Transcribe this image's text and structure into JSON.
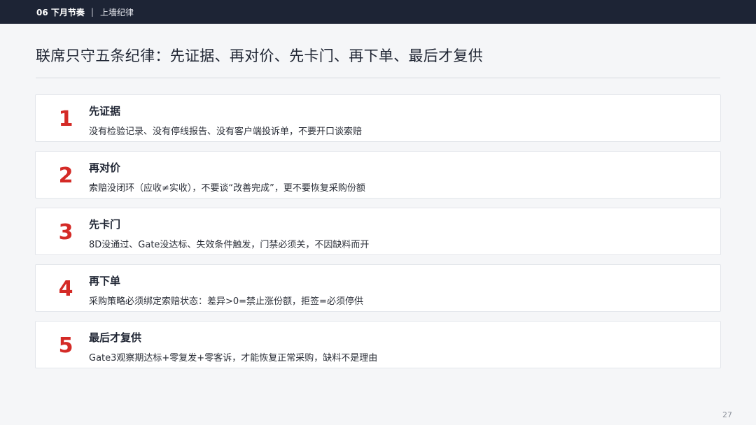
{
  "header": {
    "section_label": "06 下月节奏",
    "separator": "|",
    "subtitle": "上墙纪律"
  },
  "title": "联席只守五条纪律：先证据、再对价、先卡门、再下单、最后才复供",
  "rules": [
    {
      "number": "1",
      "heading": "先证据",
      "description": "没有检验记录、没有停线报告、没有客户端投诉单，不要开口谈索赔"
    },
    {
      "number": "2",
      "heading": "再对价",
      "description": "索赔没闭环（应收≠实收），不要谈“改善完成”，更不要恢复采购份额"
    },
    {
      "number": "3",
      "heading": "先卡门",
      "description": "8D没通过、Gate没达标、失效条件触发，门禁必须关，不因缺料而开"
    },
    {
      "number": "4",
      "heading": "再下单",
      "description": "采购策略必须绑定索赔状态：差异>0=禁止涨份额，拒签=必须停供"
    },
    {
      "number": "5",
      "heading": "最后才复供",
      "description": "Gate3观察期达标+零复发+零客诉，才能恢复正常采购，缺料不是理由"
    }
  ],
  "page_number": "27",
  "colors": {
    "topbar_bg": "#1d2435",
    "accent_number": "#d42a26",
    "page_bg": "#f5f6f8",
    "card_bg": "#ffffff"
  }
}
